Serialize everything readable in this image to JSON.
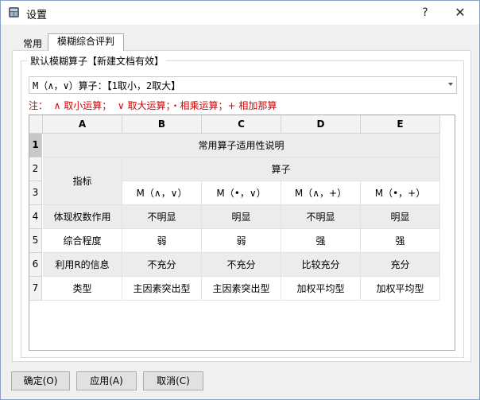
{
  "window": {
    "title": "设置",
    "help": "?",
    "close": "✕"
  },
  "tabs": [
    {
      "label": "常用",
      "active": false
    },
    {
      "label": "模糊综合评判",
      "active": true
    }
  ],
  "group": {
    "legend": "默认模糊算子【新建文档有效】",
    "combo_value": "M（∧，∨）算子：【1取小，2取大】",
    "note": "注：  ∧ 取小运算；  ∨ 取大运算；・相乘运算；+ 相加那算"
  },
  "sheet": {
    "columns": [
      "A",
      "B",
      "C",
      "D",
      "E"
    ],
    "rows": [
      "1",
      "2",
      "3",
      "4",
      "5",
      "6",
      "7"
    ],
    "r1": {
      "merged": "常用算子适用性说明"
    },
    "r2": {
      "a_merged": "指标",
      "b_merged": "算子"
    },
    "r3": {
      "b": "M（∧，∨）",
      "c": "M（•，∨）",
      "d": "M（∧，+）",
      "e": "M（•，+）"
    },
    "r4": {
      "a": "体现权数作用",
      "b": "不明显",
      "c": "明显",
      "d": "不明显",
      "e": "明显"
    },
    "r5": {
      "a": "综合程度",
      "b": "弱",
      "c": "弱",
      "d": "强",
      "e": "强"
    },
    "r6": {
      "a": "利用R的信息",
      "b": "不充分",
      "c": "不充分",
      "d": "比较充分",
      "e": "充分"
    },
    "r7": {
      "a": "类型",
      "b": "主因素突出型",
      "c": "主因素突出型",
      "d": "加权平均型",
      "e": "加权平均型"
    }
  },
  "buttons": {
    "ok": "确定(O)",
    "apply": "应用(A)",
    "cancel": "取消(C)"
  }
}
